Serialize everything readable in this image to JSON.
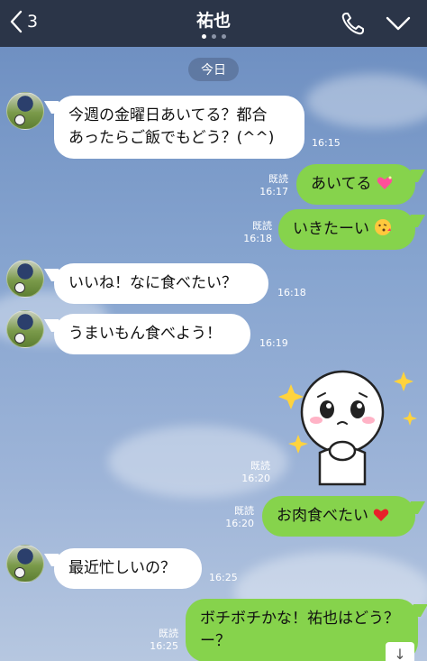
{
  "header": {
    "back_count": "3",
    "title": "祐也",
    "page_dots": 3,
    "active_dot": 0
  },
  "chat": {
    "date_chip": "今日",
    "messages": [
      {
        "dir": "in",
        "text_lines": [
          "今週の金曜日あいてる？都合",
          "あったらご飯でもどう？(^^)"
        ],
        "time": "16:15"
      },
      {
        "dir": "out",
        "text": "あいてる",
        "emoji": "sparkling-heart",
        "read": "既読",
        "time": "16:17"
      },
      {
        "dir": "out",
        "text": "いきたーい",
        "emoji": "face-blowing-kiss",
        "read": "既読",
        "time": "16:18"
      },
      {
        "dir": "in",
        "text": "いいね！なに食べたい？",
        "time": "16:18"
      },
      {
        "dir": "in",
        "text": "うまいもん食べよう！",
        "time": "16:19"
      },
      {
        "dir": "out",
        "type": "sticker",
        "sticker": "white-round-character-pleading",
        "read": "既読",
        "time": "16:20"
      },
      {
        "dir": "out",
        "text": "お肉食べたい",
        "emoji": "red-heart",
        "read": "既読",
        "time": "16:20"
      },
      {
        "dir": "in",
        "text": "最近忙しいの？",
        "time": "16:25"
      },
      {
        "dir": "out",
        "text_lines": [
          "ボチボチかな！祐也はどう？",
          "ー？"
        ],
        "read": "既読",
        "time": "16:25"
      }
    ]
  },
  "colors": {
    "header_bg": "#2b3548",
    "chat_bg": "#7b9bc8",
    "bubble_in": "#ffffff",
    "bubble_out": "#86d34c"
  },
  "icons": {
    "back": "chevron-left-icon",
    "call": "phone-icon",
    "menu": "chevron-down-icon",
    "scroll": "scroll-down-icon"
  },
  "scroll_button_label": "↓"
}
